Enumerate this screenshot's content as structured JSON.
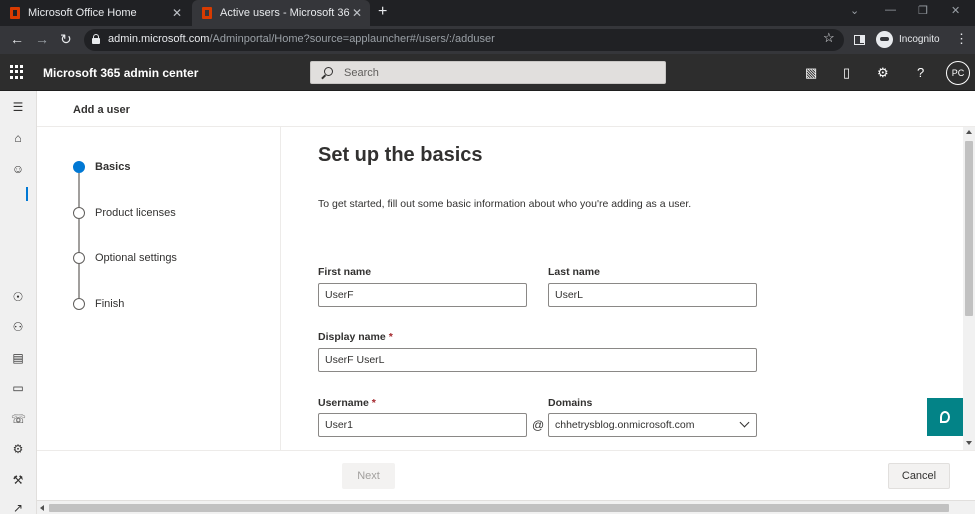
{
  "browser": {
    "tabs": [
      {
        "title": "Microsoft Office Home",
        "close": "✕"
      },
      {
        "title": "Active users - Microsoft 365 admin",
        "close": "✕"
      }
    ],
    "new_tab": "+",
    "url_host": "admin.microsoft.com",
    "url_path": "/Adminportal/Home?source=applauncher#/users/:/adduser",
    "profile_label": "Incognito",
    "window_controls": [
      "⌄",
      "—",
      "❐",
      "✕"
    ]
  },
  "header": {
    "app_title": "Microsoft 365 admin center",
    "search_placeholder": "Search",
    "avatar_initials": "PC",
    "help": "?"
  },
  "panel": {
    "title": "Add a user"
  },
  "wizard": {
    "steps": [
      {
        "label": "Basics",
        "state": "current"
      },
      {
        "label": "Product licenses",
        "state": "pending"
      },
      {
        "label": "Optional settings",
        "state": "pending"
      },
      {
        "label": "Finish",
        "state": "pending"
      }
    ]
  },
  "form": {
    "heading": "Set up the basics",
    "intro": "To get started, fill out some basic information about who you're adding as a user.",
    "first_name": {
      "label": "First name",
      "value": "UserF"
    },
    "last_name": {
      "label": "Last name",
      "value": "UserL"
    },
    "display_name": {
      "label": "Display name",
      "required": "*",
      "value": "UserF UserL"
    },
    "username": {
      "label": "Username",
      "required": "*",
      "value": "User1"
    },
    "at": "@",
    "domains": {
      "label": "Domains",
      "value": "chhetrysblog.onmicrosoft.com"
    }
  },
  "footer": {
    "next_label": "Next",
    "cancel_label": "Cancel"
  },
  "colors": {
    "accent": "#0078d4",
    "chat_button": "#038387",
    "header_bg": "#2d2d2d"
  }
}
